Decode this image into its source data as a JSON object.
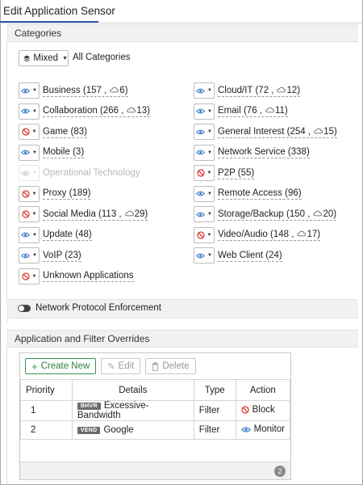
{
  "page": {
    "title": "Edit Application Sensor"
  },
  "categories_section": {
    "header": "Categories",
    "mixed_label": "Mixed",
    "all_label": "All Categories",
    "left_column": [
      {
        "name": "Business",
        "count": "(157",
        "cloud": "6)",
        "action": "monitor",
        "disabled": false
      },
      {
        "name": "Collaboration",
        "count": "(266",
        "cloud": "13)",
        "action": "monitor",
        "disabled": false
      },
      {
        "name": "Game",
        "count": "(83)",
        "cloud": "",
        "action": "block",
        "disabled": false
      },
      {
        "name": "Mobile",
        "count": "(3)",
        "cloud": "",
        "action": "monitor",
        "disabled": false
      },
      {
        "name": "Operational Technology",
        "count": "",
        "cloud": "",
        "action": "monitor",
        "disabled": true
      },
      {
        "name": "Proxy",
        "count": "(189)",
        "cloud": "",
        "action": "block",
        "disabled": false
      },
      {
        "name": "Social Media",
        "count": "(113",
        "cloud": "29)",
        "action": "block",
        "disabled": false
      },
      {
        "name": "Update",
        "count": "(48)",
        "cloud": "",
        "action": "monitor",
        "disabled": false
      },
      {
        "name": "VoIP",
        "count": "(23)",
        "cloud": "",
        "action": "monitor",
        "disabled": false
      },
      {
        "name": "Unknown Applications",
        "count": "",
        "cloud": "",
        "action": "block",
        "disabled": false
      }
    ],
    "right_column": [
      {
        "name": "Cloud/IT",
        "count": "(72",
        "cloud": "12)",
        "action": "monitor",
        "disabled": false
      },
      {
        "name": "Email",
        "count": "(76",
        "cloud": "11)",
        "action": "monitor",
        "disabled": false
      },
      {
        "name": "General Interest",
        "count": "(254",
        "cloud": "15)",
        "action": "monitor",
        "disabled": false
      },
      {
        "name": "Network Service",
        "count": "(338)",
        "cloud": "",
        "action": "monitor",
        "disabled": false
      },
      {
        "name": "P2P",
        "count": "(55)",
        "cloud": "",
        "action": "block",
        "disabled": false
      },
      {
        "name": "Remote Access",
        "count": "(96)",
        "cloud": "",
        "action": "monitor",
        "disabled": false
      },
      {
        "name": "Storage/Backup",
        "count": "(150",
        "cloud": "20)",
        "action": "monitor",
        "disabled": false
      },
      {
        "name": "Video/Audio",
        "count": "(148",
        "cloud": "17)",
        "action": "block",
        "disabled": false
      },
      {
        "name": "Web Client",
        "count": "(24)",
        "cloud": "",
        "action": "monitor",
        "disabled": false
      }
    ]
  },
  "protocol_enforcement": {
    "label": "Network Protocol Enforcement",
    "enabled": false
  },
  "overrides_section": {
    "header": "Application and Filter Overrides",
    "toolbar": {
      "create_label": "Create New",
      "edit_label": "Edit",
      "delete_label": "Delete"
    },
    "columns": [
      "Priority",
      "Details",
      "Type",
      "Action"
    ],
    "rows": [
      {
        "priority": "1",
        "badge": "BHVR",
        "details": "Excessive-Bandwidth",
        "type": "Filter",
        "action": "Block",
        "action_icon": "block"
      },
      {
        "priority": "2",
        "badge": "VEND",
        "details": "Google",
        "type": "Filter",
        "action": "Monitor",
        "action_icon": "monitor"
      }
    ],
    "count": "2"
  },
  "colors": {
    "monitor": "#2b72c2",
    "block": "#d9362b",
    "disabled": "#c9c9c9",
    "create": "#2f9a4a"
  }
}
